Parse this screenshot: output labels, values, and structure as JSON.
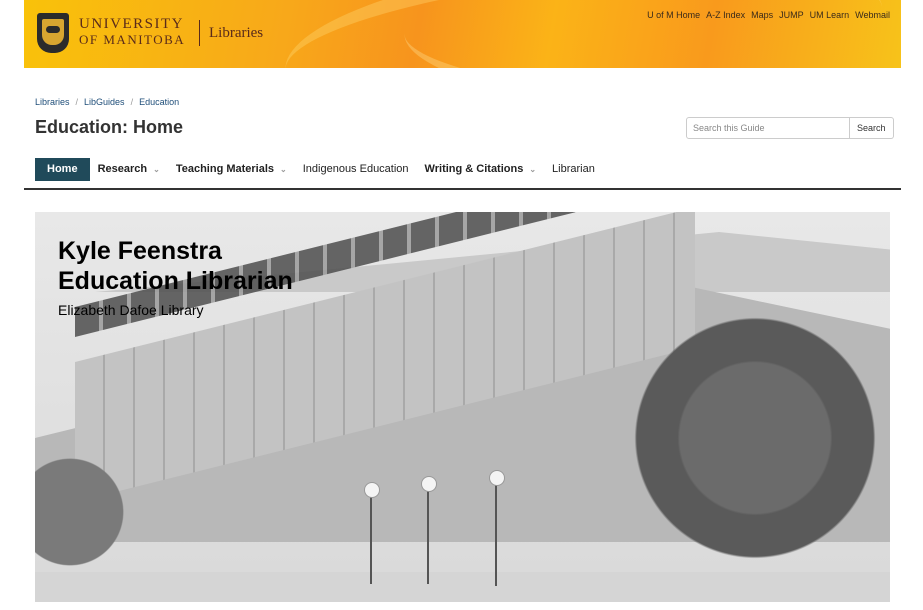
{
  "header": {
    "logo_line1": "UNIVERSITY",
    "logo_line2": "OF MANITOBA",
    "libraries_label": "Libraries",
    "top_links": [
      "U of M Home",
      "A-Z Index",
      "Maps",
      "JUMP",
      "UM Learn",
      "Webmail"
    ]
  },
  "breadcrumb": [
    "Libraries",
    "LibGuides",
    "Education"
  ],
  "page_title": "Education: Home",
  "search": {
    "placeholder": "Search this Guide",
    "button_label": "Search"
  },
  "tabs": [
    {
      "label": "Home",
      "active": true,
      "dropdown": false
    },
    {
      "label": "Research",
      "active": false,
      "dropdown": true
    },
    {
      "label": "Teaching Materials",
      "active": false,
      "dropdown": true
    },
    {
      "label": "Indigenous Education",
      "active": false,
      "dropdown": false
    },
    {
      "label": "Writing & Citations",
      "active": false,
      "dropdown": true
    },
    {
      "label": "Librarian",
      "active": false,
      "dropdown": false
    }
  ],
  "hero": {
    "name": "Kyle Feenstra",
    "role": "Education Librarian",
    "library": "Elizabeth Dafoe Library"
  },
  "colors": {
    "banner": "#f7941d",
    "active_tab": "#204a5a",
    "link": "#1f4e79"
  }
}
